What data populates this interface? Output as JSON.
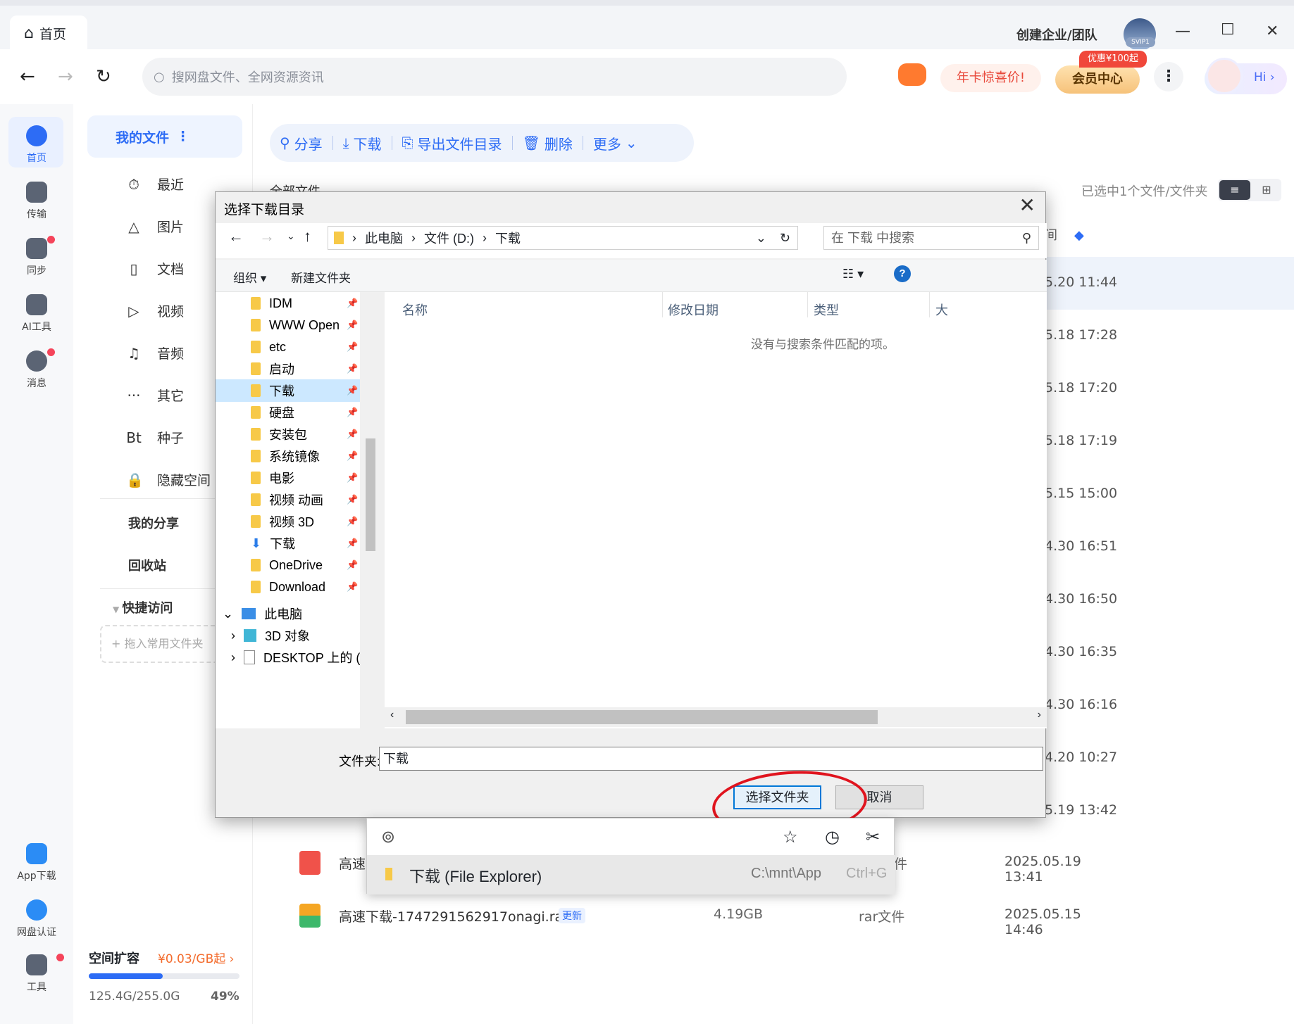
{
  "titlebar": {
    "home_tab": "首页",
    "enterprise": "创建企业/团队",
    "avatar_badge": "SVIP1"
  },
  "nav": {
    "search_placeholder": "搜网盘文件、全网资源资讯",
    "promo": "年卡惊喜价!",
    "vip_badge": "优惠¥100起",
    "vip": "会员中心",
    "hi": "Hi ›"
  },
  "rail": [
    {
      "label": "首页"
    },
    {
      "label": "传输"
    },
    {
      "label": "同步"
    },
    {
      "label": "AI工具"
    },
    {
      "label": "消息"
    },
    {
      "label": "App下载"
    },
    {
      "label": "网盘认证"
    },
    {
      "label": "工具"
    }
  ],
  "sidebar": {
    "my_files": "我的文件",
    "items": [
      {
        "icon": "⏱",
        "label": "最近"
      },
      {
        "icon": "△",
        "label": "图片"
      },
      {
        "icon": "▯",
        "label": "文档"
      },
      {
        "icon": "▷",
        "label": "视频"
      },
      {
        "icon": "♫",
        "label": "音频"
      },
      {
        "icon": "···",
        "label": "其它"
      },
      {
        "icon": "Bt",
        "label": "种子"
      },
      {
        "icon": "🔒",
        "label": "隐藏空间"
      }
    ],
    "my_share": "我的分享",
    "recycle": "回收站",
    "quick_access": "快捷访问",
    "drop_hint": "+ 拖入常用文件夹",
    "storage": {
      "title": "空间扩容",
      "price": "¥0.03/GB起 ›",
      "used": "125.4G/255.0G",
      "percent": "49%",
      "fill": 0.49
    }
  },
  "toolbar": {
    "share": "分享",
    "download": "下载",
    "export": "导出文件目录",
    "delete": "删除",
    "more": "更多"
  },
  "main": {
    "breadcrumb": "全部文件",
    "selected_info": "已选中1个文件/文件夹",
    "column_time_partial": "间",
    "dates": [
      "5.20 11:44",
      "5.18 17:28",
      "5.18 17:20",
      "5.18 17:19",
      "5.15 15:00",
      "4.30 16:51",
      "4.30 16:50",
      "4.30 16:35",
      "4.30 16:16",
      "4.20 10:27",
      "5.19 13:42"
    ],
    "rows": [
      {
        "name": "高速",
        "size": "",
        "type": "件",
        "date": "2025.05.19 13:41"
      },
      {
        "name": "高速下载-1747291562917onagi.rar",
        "tag": "更新",
        "size": "4.19GB",
        "type": "rar文件",
        "date": "2025.05.15 14:46"
      }
    ]
  },
  "dialog": {
    "title": "选择下载目录",
    "path": [
      "此电脑",
      "文件 (D:)",
      "下载"
    ],
    "search_placeholder": "在 下载 中搜索",
    "organize": "组织 ▾",
    "new_folder": "新建文件夹",
    "tree": [
      "IDM",
      "WWW Open",
      "etc",
      "启动",
      "下载",
      "硬盘",
      "安装包",
      "系统镜像",
      "电影",
      "视频 动画",
      "视频 3D",
      "下载",
      "OneDrive",
      "Download",
      "此电脑",
      "3D 对象",
      "DESKTOP 上的 ("
    ],
    "columns": {
      "name": "名称",
      "modified": "修改日期",
      "type": "类型",
      "size": "大"
    },
    "empty": "没有与搜索条件匹配的项。",
    "folder_label": "文件夹:",
    "folder_value": "下载",
    "ok": "选择文件夹",
    "cancel": "取消"
  },
  "popup": {
    "item": "下载 (File Explorer)",
    "path": "C:\\mnt\\App",
    "shortcut": "Ctrl+G"
  }
}
